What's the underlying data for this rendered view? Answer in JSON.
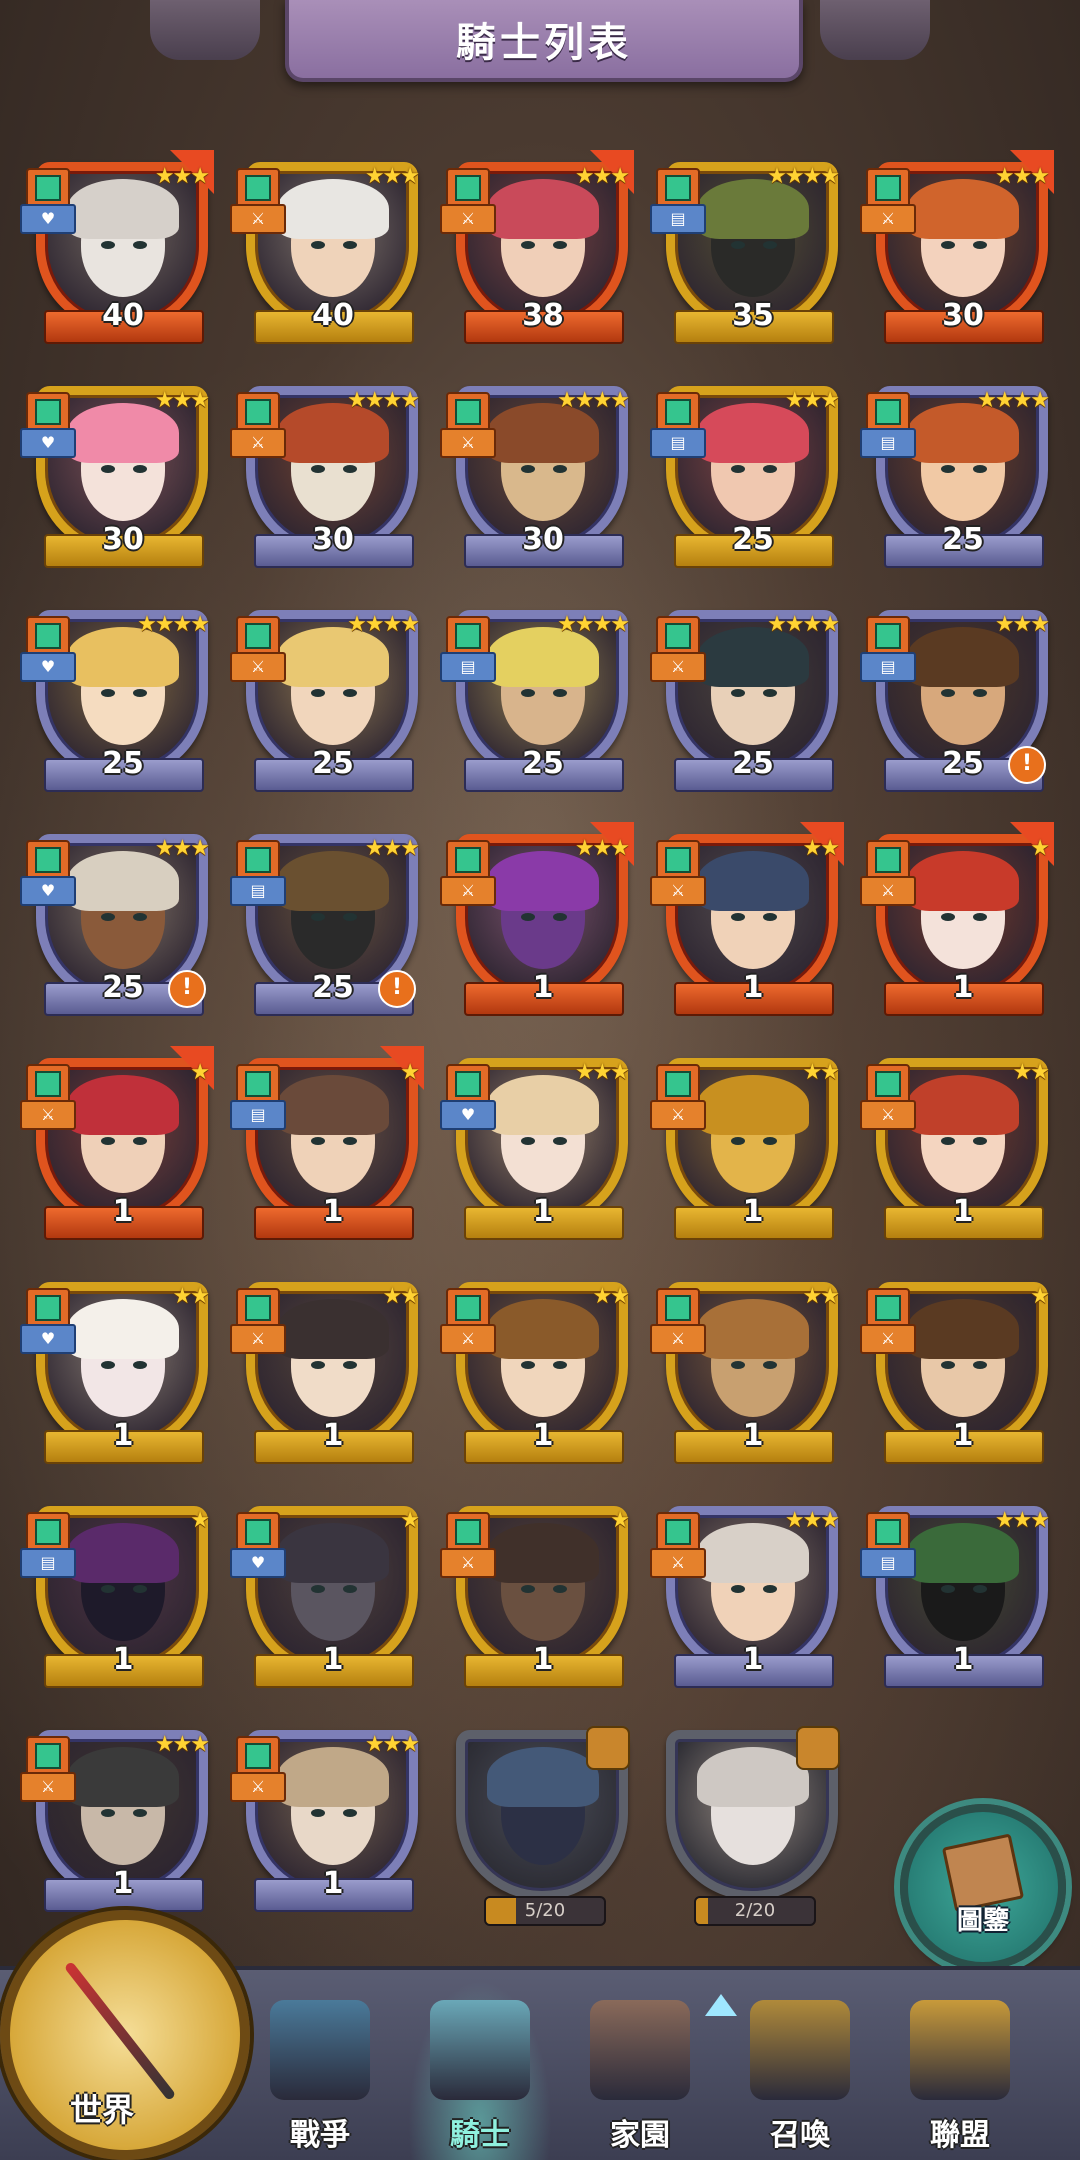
{
  "header": {
    "title": "騎士列表"
  },
  "knights": [
    {
      "level": "40",
      "stars": 3,
      "frame": "red",
      "flag": true,
      "badge": "orange-role",
      "type": "heart",
      "skin": "#e9e4df",
      "hair": "#d6d0ca"
    },
    {
      "level": "40",
      "stars": 3,
      "frame": "gold",
      "flag": false,
      "badge": "x3",
      "type": "sword",
      "skin": "#efd3ba",
      "hair": "#e8e6e2"
    },
    {
      "level": "38",
      "stars": 3,
      "frame": "red",
      "flag": true,
      "badge": "orange-role",
      "type": "sword",
      "skin": "#f0cfb8",
      "hair": "#c94a5a"
    },
    {
      "level": "35",
      "stars": 4,
      "frame": "gold",
      "flag": false,
      "badge": "gold-role",
      "type": "book",
      "skin": "#2a2a28",
      "hair": "#6a7a3a"
    },
    {
      "level": "30",
      "stars": 3,
      "frame": "red",
      "flag": true,
      "badge": "orange-role",
      "type": "sword",
      "skin": "#f3d2bd",
      "hair": "#d0642c"
    },
    {
      "level": "30",
      "stars": 3,
      "frame": "gold",
      "flag": false,
      "badge": "gold-role",
      "type": "heart",
      "skin": "#f4e2da",
      "hair": "#f08aa8"
    },
    {
      "level": "30",
      "stars": 4,
      "frame": "purple",
      "flag": false,
      "badge": "blue-role",
      "type": "sword",
      "skin": "#e9e0d0",
      "hair": "#b54a2a"
    },
    {
      "level": "30",
      "stars": 4,
      "frame": "purple",
      "flag": false,
      "badge": "x3",
      "type": "sword",
      "skin": "#d9b88c",
      "hair": "#8a4a2a"
    },
    {
      "level": "25",
      "stars": 3,
      "frame": "gold",
      "flag": false,
      "badge": "gold-role",
      "type": "book",
      "skin": "#f0c8b0",
      "hair": "#d64a5a"
    },
    {
      "level": "25",
      "stars": 4,
      "frame": "purple",
      "flag": false,
      "badge": "blue-role",
      "type": "book",
      "skin": "#f1c9a5",
      "hair": "#c45a2a"
    },
    {
      "level": "25",
      "stars": 4,
      "frame": "purple",
      "flag": false,
      "badge": "blue-role",
      "type": "heart",
      "skin": "#f5dcc0",
      "hair": "#e8c060"
    },
    {
      "level": "25",
      "stars": 4,
      "frame": "purple",
      "flag": false,
      "badge": "blue-role",
      "type": "sword",
      "skin": "#f1d6bc",
      "hair": "#e9c872"
    },
    {
      "level": "25",
      "stars": 4,
      "frame": "purple",
      "flag": false,
      "badge": "blue-role",
      "type": "book",
      "skin": "#d8b48c",
      "hair": "#e4d060"
    },
    {
      "level": "25",
      "stars": 4,
      "frame": "purple",
      "flag": false,
      "badge": "blue-role",
      "type": "sword",
      "skin": "#e8d0b8",
      "hair": "#2b3a40"
    },
    {
      "level": "25",
      "stars": 3,
      "frame": "purple",
      "flag": false,
      "badge": "blue-role",
      "type": "book",
      "skin": "#d7a87c",
      "hair": "#5a3a22",
      "alert": true
    },
    {
      "level": "25",
      "stars": 3,
      "frame": "purple",
      "flag": false,
      "badge": "blue-role",
      "type": "heart",
      "skin": "#8a5a3a",
      "hair": "#d8cfc0",
      "alert": true
    },
    {
      "level": "25",
      "stars": 3,
      "frame": "purple",
      "flag": false,
      "badge": "blue-role",
      "type": "book",
      "skin": "#2a2a2a",
      "hair": "#6a5030",
      "alert": true
    },
    {
      "level": "1",
      "stars": 3,
      "frame": "red",
      "flag": true,
      "badge": "orange-role",
      "type": "sword",
      "skin": "#6a3a8a",
      "hair": "#8a3aa8"
    },
    {
      "level": "1",
      "stars": 2,
      "frame": "red",
      "flag": true,
      "badge": "x2",
      "type": "sword",
      "skin": "#f0d2b8",
      "hair": "#3a4a6a"
    },
    {
      "level": "1",
      "stars": 1,
      "frame": "red",
      "flag": true,
      "badge": "orange-role",
      "type": "sword",
      "skin": "#f4e2da",
      "hair": "#c83a2a"
    },
    {
      "level": "1",
      "stars": 1,
      "frame": "red",
      "flag": true,
      "badge": "orange-role",
      "type": "sword",
      "skin": "#efd0b8",
      "hair": "#c0303a"
    },
    {
      "level": "1",
      "stars": 1,
      "frame": "red",
      "flag": true,
      "badge": "orange-role",
      "type": "book",
      "skin": "#efd2b8",
      "hair": "#6a4a3a"
    },
    {
      "level": "1",
      "stars": 3,
      "frame": "gold",
      "flag": false,
      "badge": "gold-role",
      "type": "heart",
      "skin": "#f3e0d3",
      "hair": "#e8cfa6"
    },
    {
      "level": "1",
      "stars": 2,
      "frame": "gold",
      "flag": false,
      "badge": "gold-role",
      "type": "sword",
      "skin": "#e3b44a",
      "hair": "#c89020"
    },
    {
      "level": "1",
      "stars": 2,
      "frame": "gold",
      "flag": false,
      "badge": "gold-role",
      "type": "sword",
      "skin": "#f4d5c0",
      "hair": "#c0402a"
    },
    {
      "level": "1",
      "stars": 2,
      "frame": "gold",
      "flag": false,
      "badge": "gold-role",
      "type": "heart",
      "skin": "#f2e6e6",
      "hair": "#f4f0ea"
    },
    {
      "level": "1",
      "stars": 2,
      "frame": "gold",
      "flag": false,
      "badge": "gold-role",
      "type": "sword",
      "skin": "#f0dcc8",
      "hair": "#3a3030"
    },
    {
      "level": "1",
      "stars": 2,
      "frame": "gold",
      "flag": false,
      "badge": "gold-role",
      "type": "sword",
      "skin": "#f0d6bc",
      "hair": "#8a5a2a"
    },
    {
      "level": "1",
      "stars": 2,
      "frame": "gold",
      "flag": false,
      "badge": "gold-role",
      "type": "sword",
      "skin": "#c8a070",
      "hair": "#a87038"
    },
    {
      "level": "1",
      "stars": 1,
      "frame": "gold",
      "flag": false,
      "badge": "gold-role",
      "type": "sword",
      "skin": "#e8c8a8",
      "hair": "#5a3a22"
    },
    {
      "level": "1",
      "stars": 1,
      "frame": "gold",
      "flag": false,
      "badge": "gold-role",
      "type": "book",
      "skin": "#1e1a2a",
      "hair": "#5a2a6a"
    },
    {
      "level": "1",
      "stars": 1,
      "frame": "gold",
      "flag": false,
      "badge": "gold-role",
      "type": "heart",
      "skin": "#5a5560",
      "hair": "#3a3540"
    },
    {
      "level": "1",
      "stars": 1,
      "frame": "gold",
      "flag": false,
      "badge": "gold-role",
      "type": "sword",
      "skin": "#6a5040",
      "hair": "#40302a"
    },
    {
      "level": "1",
      "stars": 3,
      "frame": "purple",
      "flag": false,
      "badge": "blue-role",
      "type": "sword",
      "skin": "#f0d2b8",
      "hair": "#d8d0c8"
    },
    {
      "level": "1",
      "stars": 3,
      "frame": "purple",
      "flag": false,
      "badge": "blue-role",
      "type": "book",
      "skin": "#1a1a1a",
      "hair": "#3a6a3a"
    },
    {
      "level": "1",
      "stars": 3,
      "frame": "purple",
      "flag": false,
      "badge": "blue-role",
      "type": "sword",
      "skin": "#c8b8a8",
      "hair": "#3a3a3a"
    },
    {
      "level": "1",
      "stars": 3,
      "frame": "purple",
      "flag": false,
      "badge": "blue-role",
      "type": "sword",
      "skin": "#e8d8c8",
      "hair": "#c0a888"
    }
  ],
  "shards": [
    {
      "progress": "5/20",
      "fraction": 0.25,
      "skin": "#2a3050",
      "hair": "#3a5a8a"
    },
    {
      "progress": "2/20",
      "fraction": 0.1,
      "skin": "#e8e0da",
      "hair": "#d0c8c0"
    }
  ],
  "codex": {
    "label": "圖鑒"
  },
  "nav": {
    "world": "世界",
    "items": [
      {
        "label": "戰爭",
        "color": "#4a7a9a",
        "active": false
      },
      {
        "label": "騎士",
        "color": "#6aa8b8",
        "active": true
      },
      {
        "label": "家園",
        "color": "#8a6a5a",
        "active": false
      },
      {
        "label": "召喚",
        "color": "#b08a3a",
        "active": false
      },
      {
        "label": "聯盟",
        "color": "#c89a3a",
        "active": false
      }
    ]
  }
}
